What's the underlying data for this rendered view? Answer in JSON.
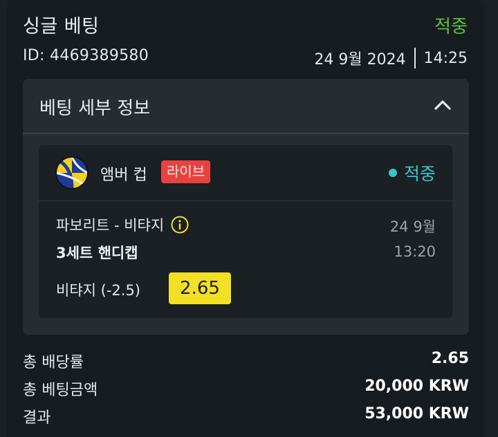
{
  "header": {
    "title": "싱글 베팅",
    "status": "적중",
    "id_text": "ID: 4469389580",
    "date": "24 9월 2024",
    "time": "14:25"
  },
  "details": {
    "title": "베팅 세부 정보",
    "collapse_icon": "chevron-up-icon"
  },
  "event": {
    "sport_icon": "volleyball-icon",
    "league": "앰버 컵",
    "live_label": "라이브",
    "status": "적중",
    "matchup": "파보리트 - 비탸지",
    "info_icon": "info-icon",
    "date": "24 9월",
    "market": "3세트 핸디캡",
    "time": "13:20",
    "selection": "비탸지 (-2.5)",
    "odds": "2.65"
  },
  "summary": [
    {
      "label": "총 배당률",
      "value": "2.65"
    },
    {
      "label": "총 베팅금액",
      "value": "20,000 KRW"
    },
    {
      "label": "결과",
      "value": "53,000 KRW"
    }
  ],
  "colors": {
    "won_green": "#5bc236",
    "won_teal": "#3cc3c8",
    "live_red": "#e8423f",
    "odds_yellow": "#f3e026",
    "card_bg": "#171c21",
    "panel_bg": "#262c32"
  }
}
